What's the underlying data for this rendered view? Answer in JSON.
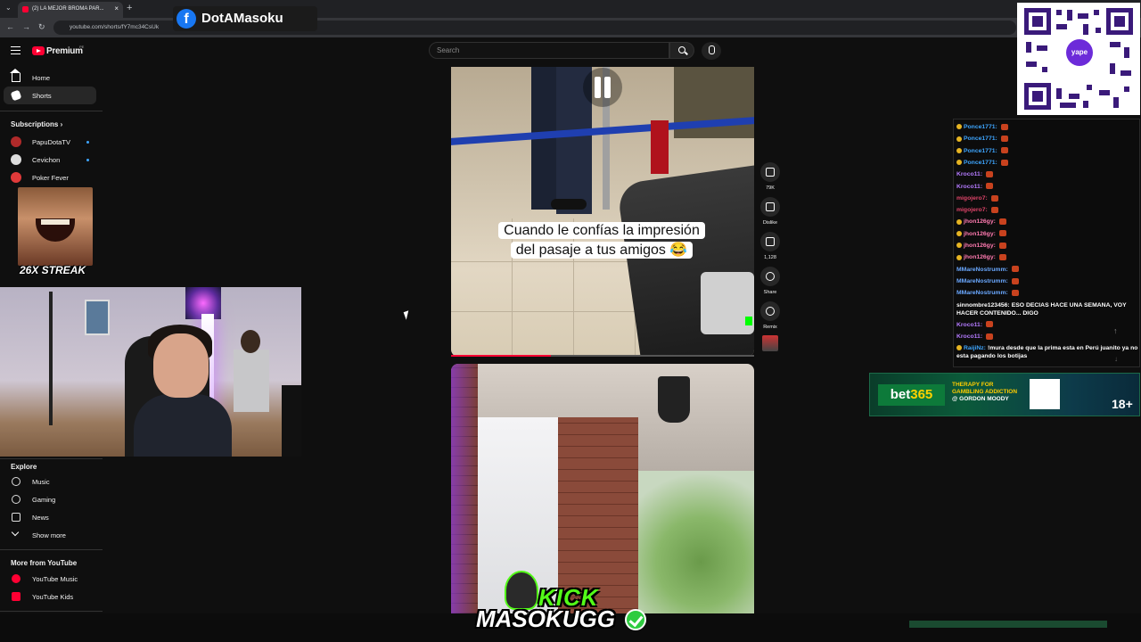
{
  "browser": {
    "tab_title": "(2) LA MEJOR BROMA PAR...",
    "url": "youtube.com/shorts/fY7mc34CsUk",
    "new_tab": "+"
  },
  "overlay": {
    "facebook_name": "DotAMasoku",
    "facebook_icon": "f",
    "streak": "26X STREAK",
    "kick_word": "KICK",
    "kick_user": "MASOKUGG",
    "yape_label": "yape"
  },
  "youtube": {
    "brand": "Premium",
    "region": "PE",
    "search_placeholder": "Search",
    "sidebar": {
      "main": [
        {
          "label": "Home",
          "icon": "home-icon"
        },
        {
          "label": "Shorts",
          "icon": "shorts-icon"
        }
      ],
      "subscriptions_heading": "Subscriptions",
      "subscriptions": [
        {
          "label": "PapuDotaTV",
          "color": "#b02a2a"
        },
        {
          "label": "Cevichon",
          "color": "#dddddd"
        },
        {
          "label": "Poker Fever",
          "color": "#e03a3a"
        }
      ],
      "explore_heading": "Explore",
      "explore": [
        {
          "label": "Music",
          "icon": "music-icon"
        },
        {
          "label": "Gaming",
          "icon": "gaming-icon"
        },
        {
          "label": "News",
          "icon": "news-icon"
        },
        {
          "label": "Show more",
          "icon": "chevron-down-icon"
        }
      ],
      "more_heading": "More from YouTube",
      "more": [
        {
          "label": "YouTube Music",
          "icon": "youtube-music-icon"
        },
        {
          "label": "YouTube Kids",
          "icon": "youtube-kids-icon"
        }
      ]
    },
    "short": {
      "caption_line1": "Cuando le confías la impresión",
      "caption_line2": "del pasaje a tus amigos 😂",
      "progress": 0.33,
      "actions": [
        {
          "label": "79K",
          "icon": "like-icon"
        },
        {
          "label": "Dislike",
          "icon": "dislike-icon"
        },
        {
          "label": "1,128",
          "icon": "comment-icon"
        },
        {
          "label": "Share",
          "icon": "share-icon"
        },
        {
          "label": "Remix",
          "icon": "remix-icon"
        }
      ]
    }
  },
  "chat": [
    {
      "user": "Ponce1771:",
      "msg": "",
      "color": "#3ea6ff",
      "badge": true
    },
    {
      "user": "Ponce1771:",
      "msg": "",
      "color": "#3ea6ff",
      "badge": true
    },
    {
      "user": "Ponce1771:",
      "msg": "",
      "color": "#3ea6ff",
      "badge": true
    },
    {
      "user": "Ponce1771:",
      "msg": "",
      "color": "#3ea6ff",
      "badge": true
    },
    {
      "user": "Kroco11:",
      "msg": "",
      "color": "#b57bff",
      "badge": false
    },
    {
      "user": "Kroco11:",
      "msg": "",
      "color": "#b57bff",
      "badge": false
    },
    {
      "user": "migojero7:",
      "msg": "",
      "color": "#e0446a",
      "badge": false
    },
    {
      "user": "migojero7:",
      "msg": "",
      "color": "#e0446a",
      "badge": false
    },
    {
      "user": "jhon126gy:",
      "msg": "",
      "color": "#ff7ab0",
      "badge": true
    },
    {
      "user": "jhon126gy:",
      "msg": "",
      "color": "#ff7ab0",
      "badge": true
    },
    {
      "user": "jhon126gy:",
      "msg": "",
      "color": "#ff7ab0",
      "badge": true
    },
    {
      "user": "jhon126gy:",
      "msg": "",
      "color": "#ff7ab0",
      "badge": true
    },
    {
      "user": "MMareNostrumm:",
      "msg": "",
      "color": "#6aa8ff",
      "badge": false
    },
    {
      "user": "MMareNostrumm:",
      "msg": "",
      "color": "#6aa8ff",
      "badge": false
    },
    {
      "user": "MMareNostrumm:",
      "msg": "",
      "color": "#6aa8ff",
      "badge": false
    },
    {
      "user": "sinnombre123456:",
      "msg": "ESO DECIAS HACE UNA SEMANA, VOY HACER CONTENIDO... DIGO",
      "color": "#ffffff",
      "badge": false
    },
    {
      "user": "Kroco11:",
      "msg": "",
      "color": "#b57bff",
      "badge": false
    },
    {
      "user": "Kroco11:",
      "msg": "",
      "color": "#b57bff",
      "badge": false
    },
    {
      "user": "RaijiNz:",
      "msg": "!mura desde que la prima esta en Perú juanito ya no esta pagando los botijas",
      "color": "#3ea6ff",
      "badge": true
    }
  ],
  "ad": {
    "brand": "bet",
    "brand_num": "365",
    "line1": "THERAPY FOR",
    "line2": "GAMBLING ADDICTION",
    "line3": "@ GORDON MOODY",
    "age": "18+"
  },
  "colors": {
    "accent": "#ff0033",
    "kick_green": "#53fc18"
  }
}
